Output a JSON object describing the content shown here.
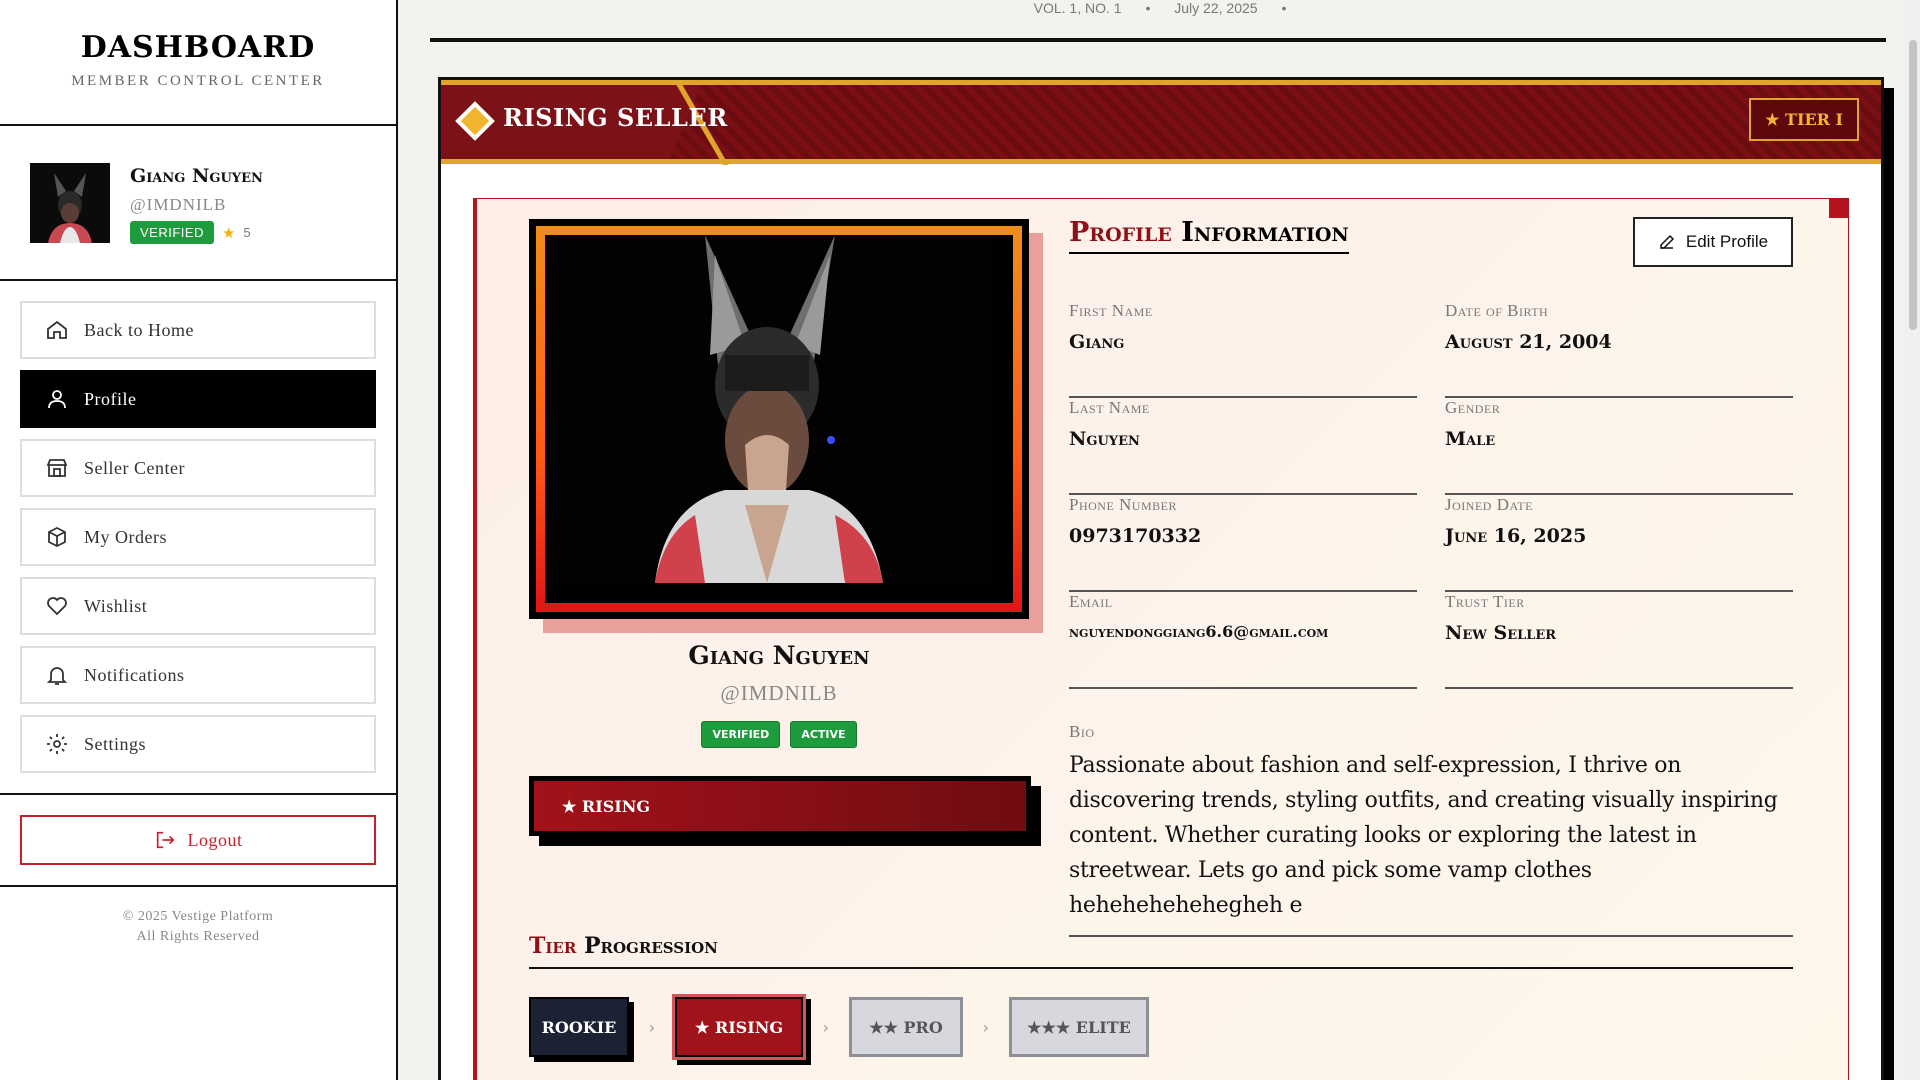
{
  "sidebar": {
    "title": "DASHBOARD",
    "subtitle": "MEMBER CONTROL CENTER",
    "user": {
      "name": "Giang Nguyen",
      "handle": "@IMDNILB",
      "badge": "VERIFIED",
      "stars": "5"
    },
    "nav": [
      {
        "label": "Back to Home",
        "icon": "home-icon"
      },
      {
        "label": "Profile",
        "icon": "user-icon"
      },
      {
        "label": "Seller Center",
        "icon": "store-icon"
      },
      {
        "label": "My Orders",
        "icon": "box-icon"
      },
      {
        "label": "Wishlist",
        "icon": "heart-icon"
      },
      {
        "label": "Notifications",
        "icon": "bell-icon"
      },
      {
        "label": "Settings",
        "icon": "gear-icon"
      }
    ],
    "logout_label": "Logout",
    "footer_line1": "© 2025 Vestige Platform",
    "footer_line2": "All Rights Reserved"
  },
  "header": {
    "volume": "VOL. 1, NO. 1",
    "date": "July 22, 2025",
    "sep": "•"
  },
  "banner": {
    "title": "RISING SELLER",
    "tier_badge": "★ TIER I"
  },
  "profile": {
    "name": "Giang Nguyen",
    "handle": "@IMDNILB",
    "badges": [
      "VERIFIED",
      "ACTIVE"
    ],
    "rank_bar": "★ RISING"
  },
  "info": {
    "title_red": "Profile",
    "title_black": "Information",
    "edit_label": "Edit Profile",
    "fields": [
      {
        "label": "First Name",
        "value": "Giang"
      },
      {
        "label": "Date of Birth",
        "value": "August 21, 2004"
      },
      {
        "label": "Last Name",
        "value": "Nguyen"
      },
      {
        "label": "Gender",
        "value": "Male"
      },
      {
        "label": "Phone Number",
        "value": "0973170332"
      },
      {
        "label": "Joined Date",
        "value": "June 16, 2025"
      },
      {
        "label": "Email",
        "value": "nguyendonggiang6.6@gmail.com"
      },
      {
        "label": "Trust Tier",
        "value": "New Seller"
      }
    ],
    "bio_label": "Bio",
    "bio": "Passionate about fashion and self-expression, I thrive on discovering trends, styling outfits, and creating visually inspiring content. Whether curating looks or exploring the latest in streetwear. Lets go and pick some vamp clothes hehehehehehegheh e"
  },
  "tier": {
    "title_red": "Tier",
    "title_black": "Progression",
    "steps": [
      "ROOKIE",
      "★ RISING",
      "★★ PRO",
      "★★★ ELITE"
    ],
    "chevron": "›"
  },
  "colors": {
    "brand_red": "#8e1118",
    "gold": "#e0a52a",
    "verified_green": "#1e9b3c"
  }
}
